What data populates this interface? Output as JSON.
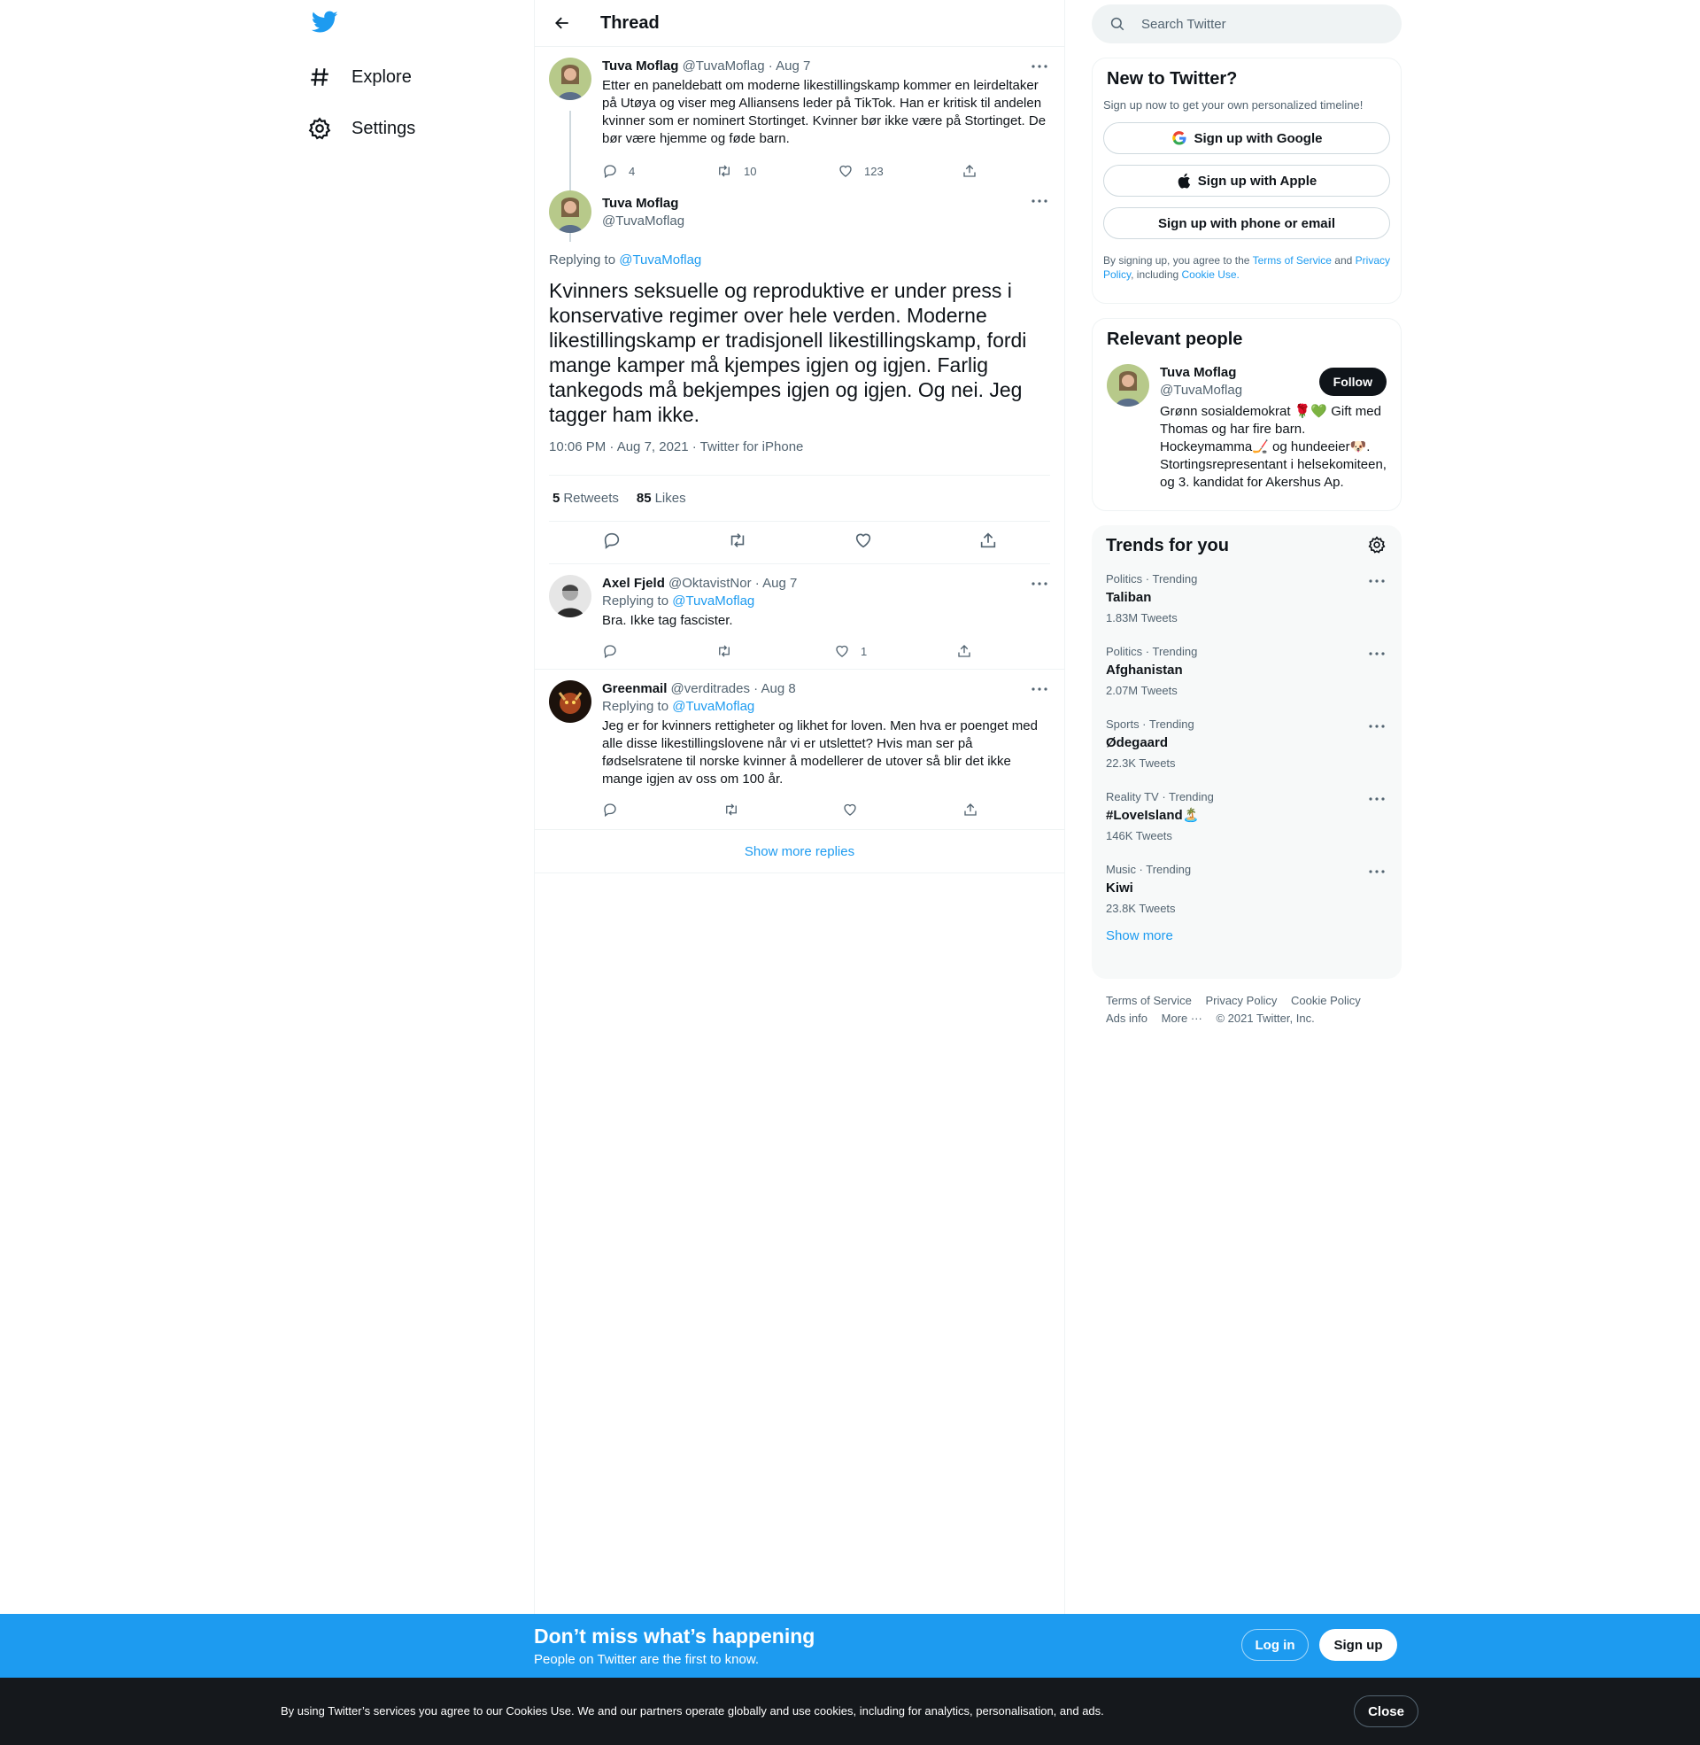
{
  "nav": {
    "explore_label": "Explore",
    "settings_label": "Settings"
  },
  "header": {
    "title": "Thread"
  },
  "parent_tweet": {
    "name": "Tuva Moflag",
    "handle": "@TuvaMoflag",
    "date": "Aug 7",
    "text": "Etter en paneldebatt om moderne likestillingskamp kommer en leirdeltaker på Utøya og viser meg Alliansens leder på TikTok. Han er kritisk til andelen kvinner som er nominert Stortinget. Kvinner bør ikke være på Stortinget. De bør være hjemme og føde barn.",
    "replies": "4",
    "retweets": "10",
    "likes": "123"
  },
  "focal_tweet": {
    "name": "Tuva Moflag",
    "handle": "@TuvaMoflag",
    "replying_prefix": "Replying to",
    "replying_to": "@TuvaMoflag",
    "text": "Kvinners seksuelle og reproduktive er under press i konservative regimer over hele verden. Moderne likestillingskamp er tradisjonell likestillingskamp, fordi mange kamper må kjempes igjen og igjen. Farlig tankegods må bekjempes igjen og igjen. Og nei. Jeg tagger ham ikke.",
    "timestamp": "10:06 PM · Aug 7, 2021 · Twitter for iPhone",
    "retweets_count": "5",
    "retweets_label": "Retweets",
    "likes_count": "85",
    "likes_label": "Likes"
  },
  "replies": [
    {
      "name": "Axel Fjeld",
      "handle": "@OktavistNor",
      "date": "Aug 7",
      "replying_prefix": "Replying to",
      "replying_to": "@TuvaMoflag",
      "text": "Bra. Ikke tag fascister.",
      "likes": "1"
    },
    {
      "name": "Greenmail",
      "handle": "@verditrades",
      "date": "Aug 8",
      "replying_prefix": "Replying to",
      "replying_to": "@TuvaMoflag",
      "text": "Jeg er for kvinners rettigheter og likhet for loven. Men hva er poenget med alle disse likestillingslovene når vi er utslettet? Hvis man ser på fødselsratene til norske kvinner å modellerer de utover så blir det ikke mange igjen av oss om 100 år."
    }
  ],
  "show_more_replies": "Show more replies",
  "search": {
    "placeholder": "Search Twitter"
  },
  "signup_card": {
    "title": "New to Twitter?",
    "subtitle": "Sign up now to get your own personalized timeline!",
    "google": "Sign up with Google",
    "apple": "Sign up with Apple",
    "phone": "Sign up with phone or email",
    "legal_1": "By signing up, you agree to the",
    "tos": "Terms of Service",
    "legal_2": "and",
    "privacy": "Privacy Policy",
    "legal_3": ", including",
    "cookie": "Cookie Use."
  },
  "relevant_people": {
    "title": "Relevant people",
    "name": "Tuva Moflag",
    "handle": "@TuvaMoflag",
    "follow": "Follow",
    "bio": "Grønn sosialdemokrat 🌹💚 Gift med Thomas og har fire barn. Hockeymamma🏒 og hundeeier🐶. Stortingsrepresentant i helsekomiteen, og 3. kandidat for Akershus Ap."
  },
  "trends": {
    "title": "Trends for you",
    "items": [
      {
        "meta": "Politics · Trending",
        "name": "Taliban",
        "count": "1.83M Tweets"
      },
      {
        "meta": "Politics · Trending",
        "name": "Afghanistan",
        "count": "2.07M Tweets"
      },
      {
        "meta": "Sports · Trending",
        "name": "Ødegaard",
        "count": "22.3K Tweets"
      },
      {
        "meta": "Reality TV · Trending",
        "name": "#LoveIsland🏝️",
        "count": "146K Tweets"
      },
      {
        "meta": "Music · Trending",
        "name": "Kiwi",
        "count": "23.8K Tweets"
      }
    ],
    "show_more": "Show more"
  },
  "footer": {
    "tos": "Terms of Service",
    "privacy": "Privacy Policy",
    "cookie": "Cookie Policy",
    "ads": "Ads info",
    "more": "More ···",
    "copyright": "© 2021 Twitter, Inc."
  },
  "banner": {
    "title": "Don’t miss what’s happening",
    "subtitle": "People on Twitter are the first to know.",
    "login": "Log in",
    "signup": "Sign up"
  },
  "cookies": {
    "text": "By using Twitter’s services you agree to our Cookies Use. We and our partners operate globally and use cookies, including for analytics, personalisation, and ads.",
    "close": "Close"
  },
  "colors": {
    "brand": "#1d9bf0",
    "text": "#0f1419",
    "muted": "#536471",
    "cookie_bar": "#15181c"
  }
}
